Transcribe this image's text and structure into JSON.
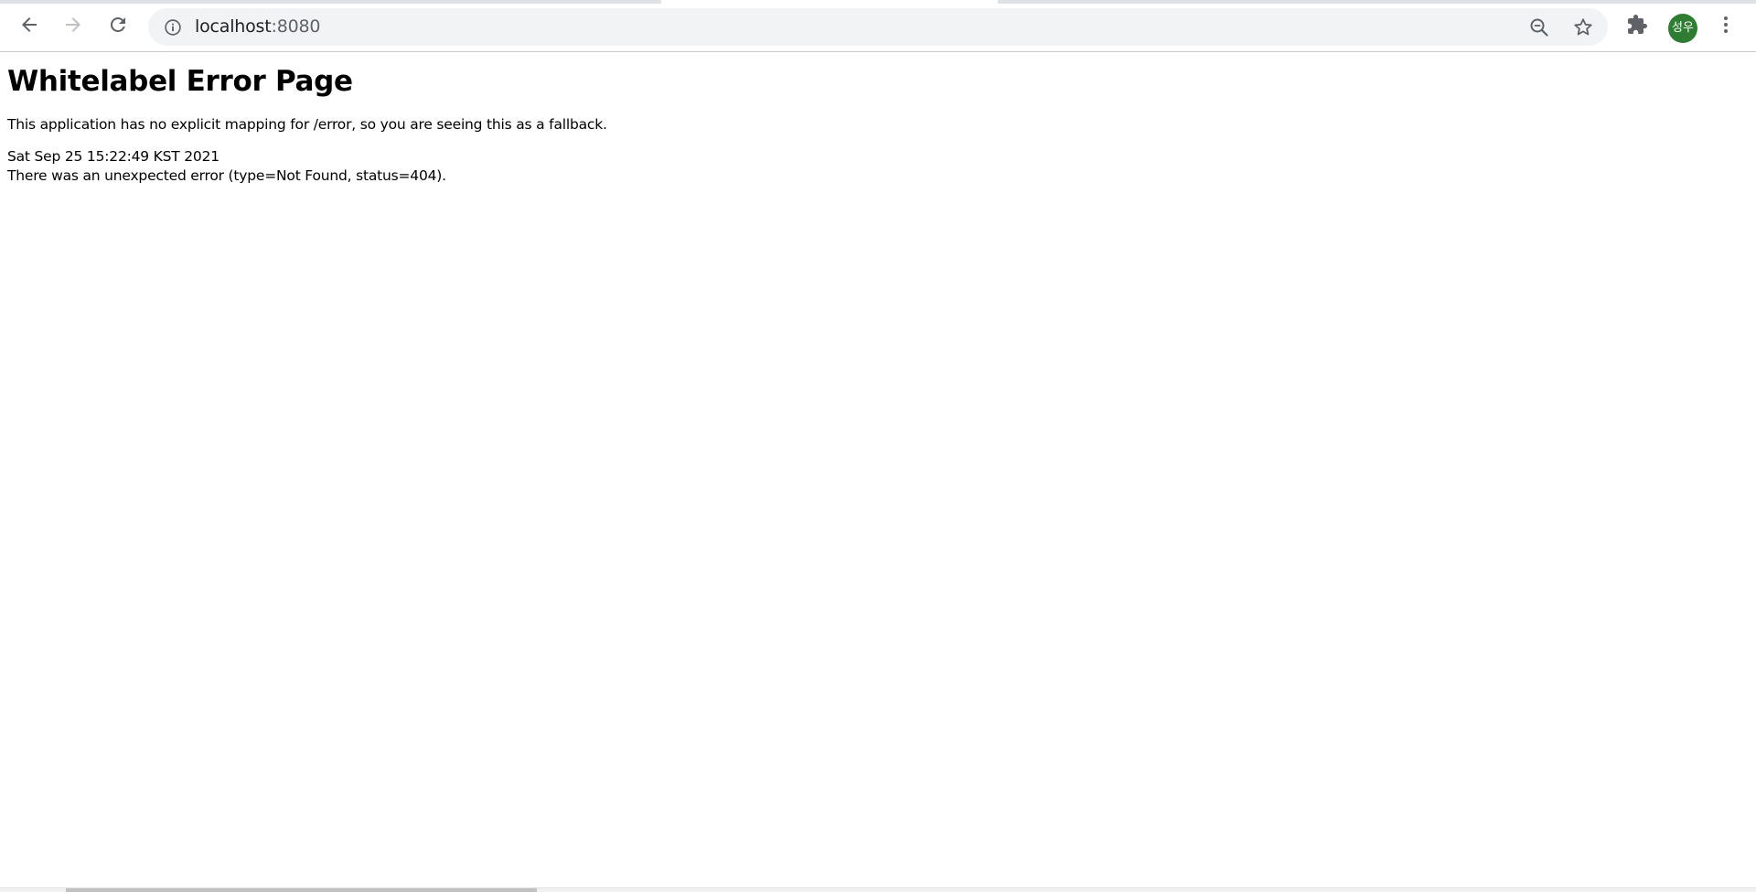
{
  "browser": {
    "url_host": "localhost",
    "url_port": ":8080",
    "profile_initials": "성우",
    "icons": {
      "back": "arrow-left-icon",
      "forward": "arrow-right-icon",
      "reload": "reload-icon",
      "site_info": "info-circle-icon",
      "zoom": "zoom-out-icon",
      "bookmark": "star-icon",
      "extensions": "puzzle-piece-icon",
      "menu": "three-dots-vertical-icon"
    },
    "forward_enabled": false,
    "colors": {
      "omnibox_bg": "#f1f3f4",
      "avatar_bg": "#2e7d32",
      "icon": "#5f6368"
    }
  },
  "page": {
    "title": "Whitelabel Error Page",
    "message": "This application has no explicit mapping for /error, so you are seeing this as a fallback.",
    "timestamp": "Sat Sep 25 15:22:49 KST 2021",
    "error_detail": "There was an unexpected error (type=Not Found, status=404)."
  }
}
